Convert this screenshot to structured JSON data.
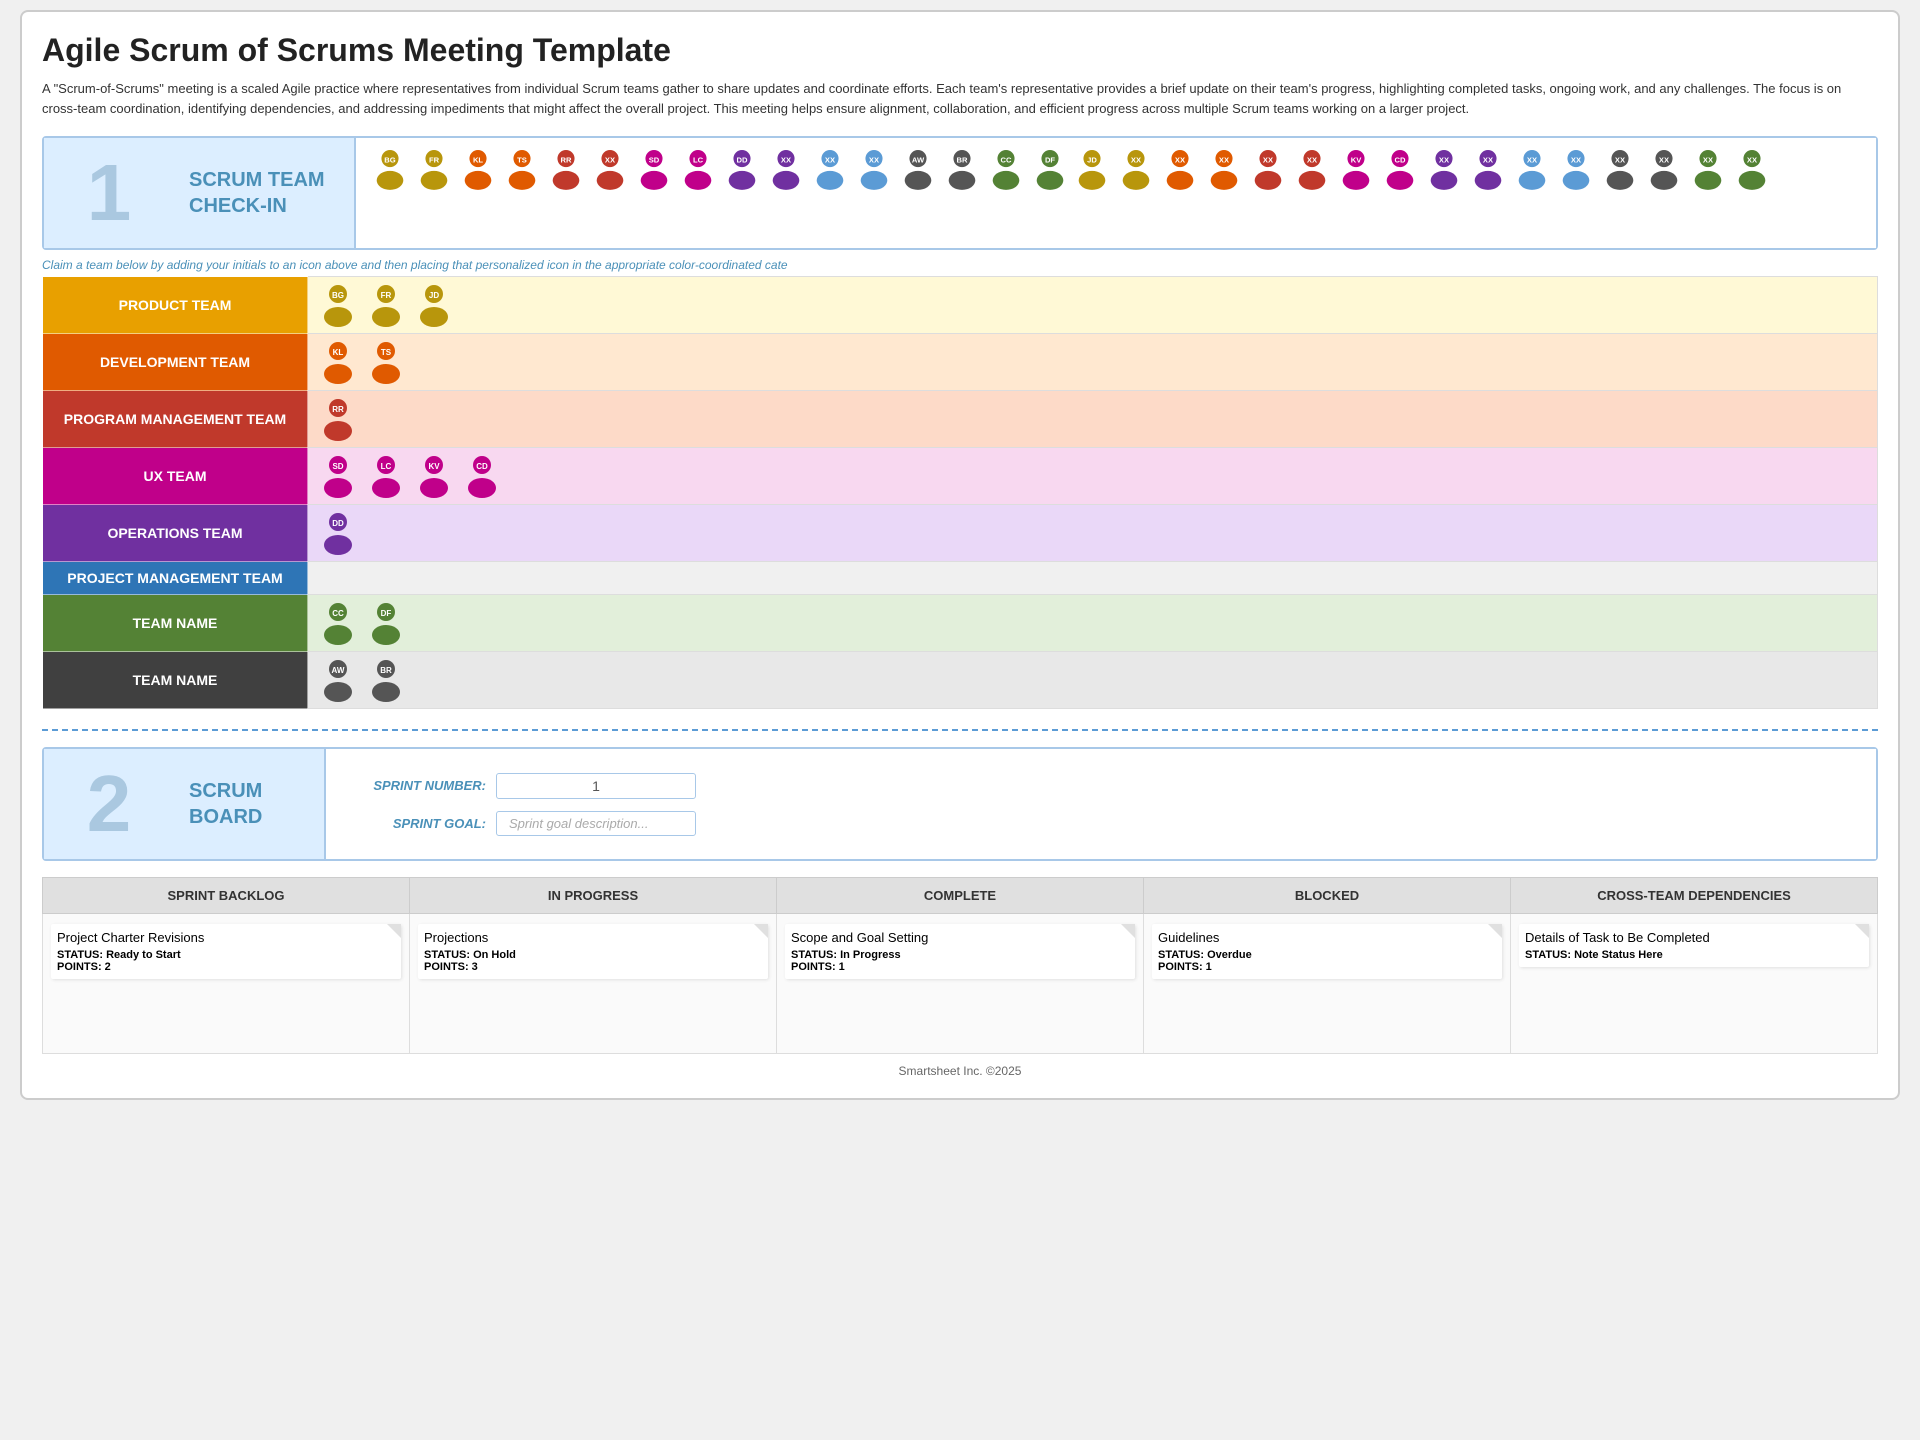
{
  "page": {
    "title": "Agile Scrum of Scrums Meeting Template",
    "description": "A \"Scrum-of-Scrums\" meeting is a scaled Agile practice where representatives from individual Scrum teams gather to share updates and coordinate efforts. Each team's representative provides a brief update on their team's progress, highlighting completed tasks, ongoing work, and any challenges. The focus is on cross-team coordination, identifying dependencies, and addressing impediments that might affect the overall project. This meeting helps ensure alignment, collaboration, and efficient progress across multiple Scrum teams working on a larger project.",
    "claim_instruction": "Claim a team below by adding your initials to an icon above and then placing that personalized icon in the appropriate color-coordinated cate"
  },
  "section1": {
    "number": "1",
    "label_line1": "SCRUM TEAM",
    "label_line2": "CHECK-IN"
  },
  "section2": {
    "number": "2",
    "label_line1": "SCRUM",
    "label_line2": "BOARD",
    "sprint_number_label": "SPRINT NUMBER:",
    "sprint_number_value": "1",
    "sprint_goal_label": "SPRINT GOAL:",
    "sprint_goal_placeholder": "Sprint goal description..."
  },
  "teams": [
    {
      "name": "PRODUCT TEAM",
      "bg_color": "#E8A000",
      "row_color": "#FFF9D6",
      "members": [
        {
          "initials": "BG",
          "color": "#B8960C"
        },
        {
          "initials": "FR",
          "color": "#B8960C"
        },
        {
          "initials": "JD",
          "color": "#B8960C"
        }
      ]
    },
    {
      "name": "DEVELOPMENT TEAM",
      "bg_color": "#E05A00",
      "row_color": "#FFE8D0",
      "members": [
        {
          "initials": "KL",
          "color": "#E05A00"
        },
        {
          "initials": "TS",
          "color": "#E05A00"
        }
      ]
    },
    {
      "name": "PROGRAM MANAGEMENT TEAM",
      "bg_color": "#C0392B",
      "row_color": "#FDDAC8",
      "members": [
        {
          "initials": "RR",
          "color": "#C0392B"
        }
      ]
    },
    {
      "name": "UX TEAM",
      "bg_color": "#C0008A",
      "row_color": "#F8D8F0",
      "members": [
        {
          "initials": "SD",
          "color": "#C0008A"
        },
        {
          "initials": "LC",
          "color": "#C0008A"
        },
        {
          "initials": "KV",
          "color": "#C0008A"
        },
        {
          "initials": "CD",
          "color": "#C0008A"
        }
      ]
    },
    {
      "name": "OPERATIONS TEAM",
      "bg_color": "#7030A0",
      "row_color": "#EAD8F8",
      "members": [
        {
          "initials": "DD",
          "color": "#7030A0"
        }
      ]
    },
    {
      "name": "PROJECT MANAGEMENT TEAM",
      "bg_color": "#2E75B6",
      "row_color": "#F0F0F0",
      "members": []
    },
    {
      "name": "TEAM NAME",
      "bg_color": "#548235",
      "row_color": "#E2EFDA",
      "members": [
        {
          "initials": "CC",
          "color": "#548235"
        },
        {
          "initials": "DF",
          "color": "#548235"
        }
      ]
    },
    {
      "name": "TEAM NAME",
      "bg_color": "#404040",
      "row_color": "#E8E8E8",
      "members": [
        {
          "initials": "AW",
          "color": "#555"
        },
        {
          "initials": "BR",
          "color": "#555"
        }
      ]
    }
  ],
  "header_avatars_row1": [
    {
      "initials": "BG",
      "color": "#B8960C"
    },
    {
      "initials": "FR",
      "color": "#B8960C"
    },
    {
      "initials": "KL",
      "color": "#E05A00"
    },
    {
      "initials": "TS",
      "color": "#E05A00"
    },
    {
      "initials": "RR",
      "color": "#C0392B"
    },
    {
      "initials": "XX",
      "color": "#C0392B"
    },
    {
      "initials": "SD",
      "color": "#C0008A"
    },
    {
      "initials": "LC",
      "color": "#C0008A"
    },
    {
      "initials": "DD",
      "color": "#7030A0"
    },
    {
      "initials": "XX",
      "color": "#7030A0"
    },
    {
      "initials": "XX",
      "color": "#5B9BD5"
    },
    {
      "initials": "XX",
      "color": "#5B9BD5"
    },
    {
      "initials": "AW",
      "color": "#555"
    },
    {
      "initials": "BR",
      "color": "#555"
    },
    {
      "initials": "CC",
      "color": "#548235"
    },
    {
      "initials": "DF",
      "color": "#548235"
    }
  ],
  "header_avatars_row2": [
    {
      "initials": "JD",
      "color": "#B8960C"
    },
    {
      "initials": "XX",
      "color": "#B8960C"
    },
    {
      "initials": "XX",
      "color": "#E05A00"
    },
    {
      "initials": "XX",
      "color": "#E05A00"
    },
    {
      "initials": "XX",
      "color": "#C0392B"
    },
    {
      "initials": "XX",
      "color": "#C0392B"
    },
    {
      "initials": "KV",
      "color": "#C0008A"
    },
    {
      "initials": "CD",
      "color": "#C0008A"
    },
    {
      "initials": "XX",
      "color": "#7030A0"
    },
    {
      "initials": "XX",
      "color": "#7030A0"
    },
    {
      "initials": "XX",
      "color": "#5B9BD5"
    },
    {
      "initials": "XX",
      "color": "#5B9BD5"
    },
    {
      "initials": "XX",
      "color": "#555"
    },
    {
      "initials": "XX",
      "color": "#555"
    },
    {
      "initials": "XX",
      "color": "#548235"
    },
    {
      "initials": "XX",
      "color": "#548235"
    }
  ],
  "sprint_board": {
    "columns": [
      "SPRINT BACKLOG",
      "IN PROGRESS",
      "COMPLETE",
      "BLOCKED",
      "CROSS-TEAM DEPENDENCIES"
    ],
    "cards": [
      {
        "title": "Project Charter Revisions",
        "status": "STATUS: Ready to Start",
        "points": "POINTS: 2"
      },
      {
        "title": "Projections",
        "status": "STATUS: On Hold",
        "points": "POINTS: 3"
      },
      {
        "title": "Scope and Goal Setting",
        "status": "STATUS: In Progress",
        "points": "POINTS: 1"
      },
      {
        "title": "Guidelines",
        "status": "STATUS: Overdue",
        "points": "POINTS: 1"
      },
      {
        "title": "Details of Task to Be Completed",
        "status": "STATUS: Note Status Here",
        "points": ""
      }
    ]
  },
  "footer": {
    "text": "Smartsheet Inc. ©2025"
  }
}
